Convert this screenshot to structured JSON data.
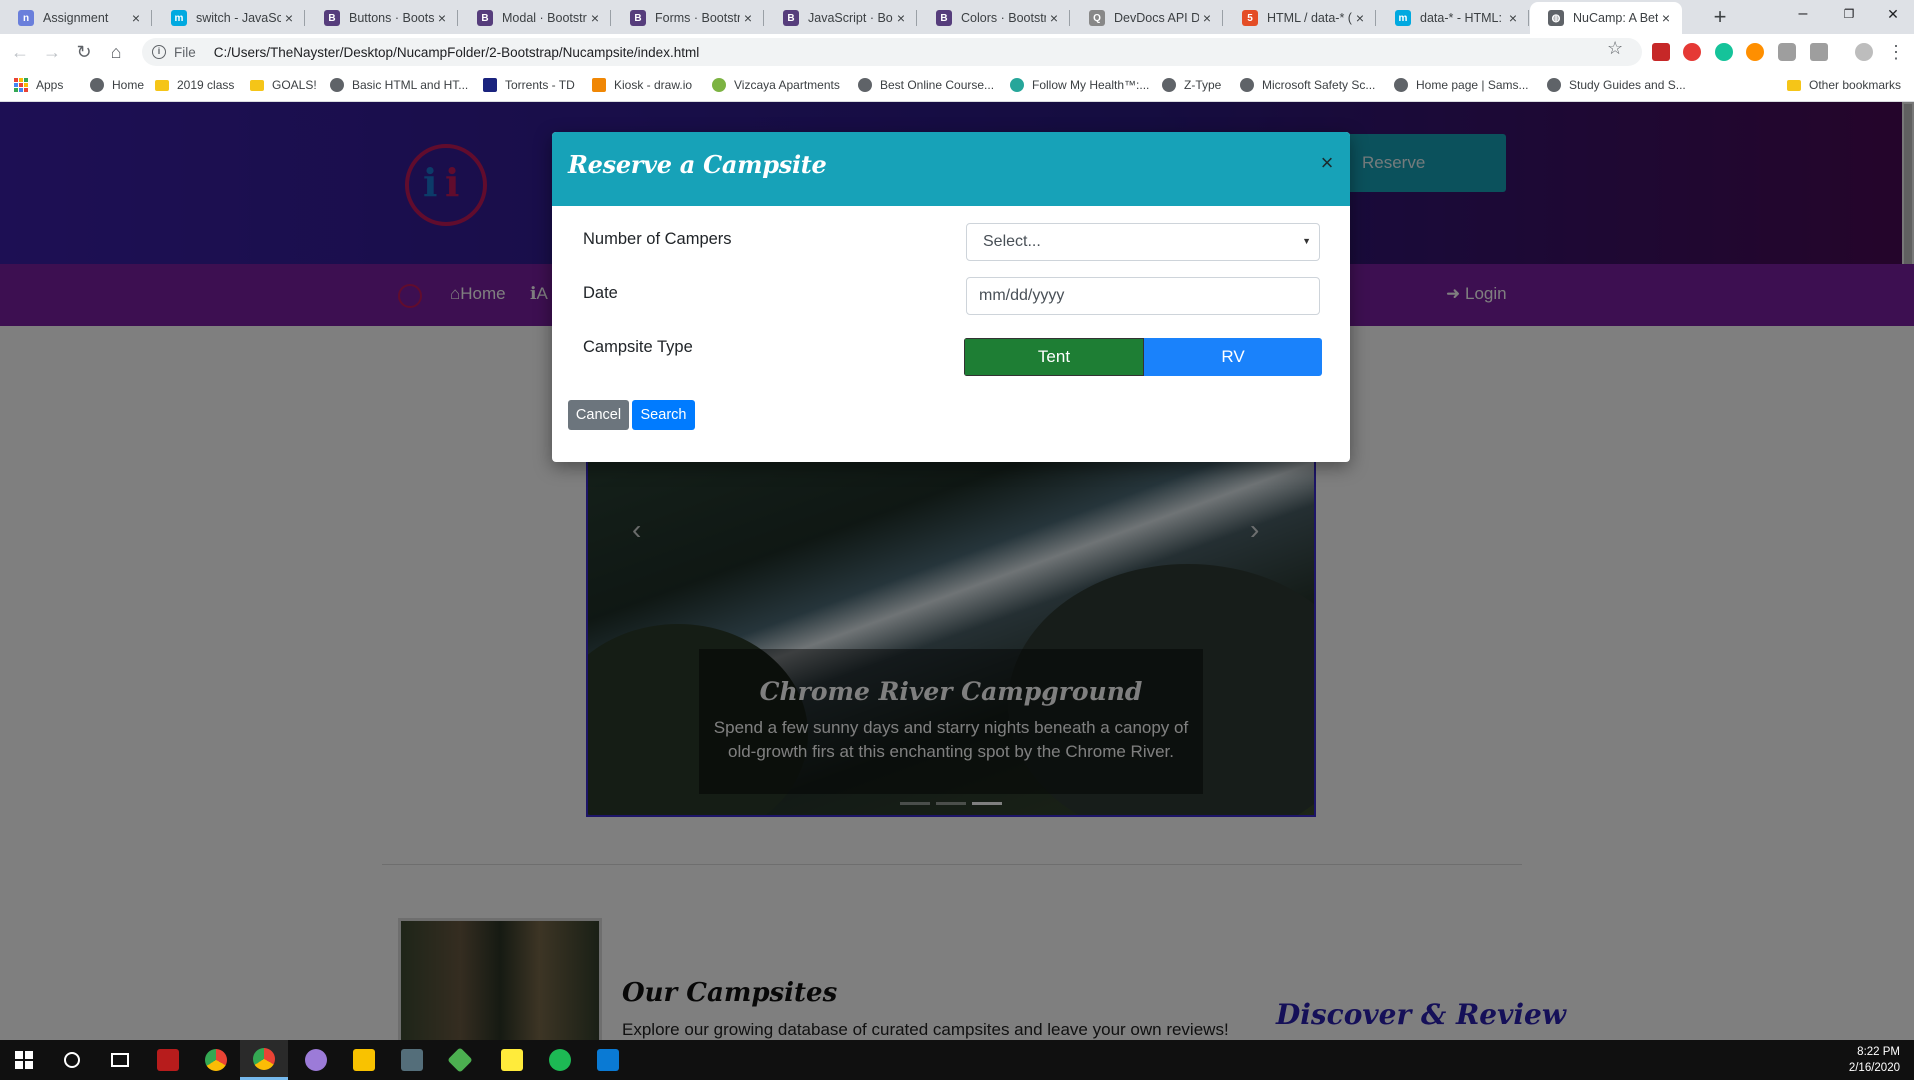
{
  "browser": {
    "tabs": [
      {
        "title": "Assignment",
        "favicon_color": "#6a7fdb",
        "favicon_glyph": "n"
      },
      {
        "title": "switch - JavaScrip",
        "favicon_color": "#00a9e0",
        "favicon_glyph": "m"
      },
      {
        "title": "Buttons · Bootstr",
        "favicon_color": "#563d7c",
        "favicon_glyph": "B"
      },
      {
        "title": "Modal · Bootstra",
        "favicon_color": "#563d7c",
        "favicon_glyph": "B"
      },
      {
        "title": "Forms · Bootstrap",
        "favicon_color": "#563d7c",
        "favicon_glyph": "B"
      },
      {
        "title": "JavaScript · Boot",
        "favicon_color": "#563d7c",
        "favicon_glyph": "B"
      },
      {
        "title": "Colors · Bootstra",
        "favicon_color": "#563d7c",
        "favicon_glyph": "B"
      },
      {
        "title": "DevDocs API Doc",
        "favicon_color": "#888888",
        "favicon_glyph": "Q"
      },
      {
        "title": "HTML / data-* (a",
        "favicon_color": "#e44d26",
        "favicon_glyph": "5"
      },
      {
        "title": "data-* - HTML: H",
        "favicon_color": "#00a9e0",
        "favicon_glyph": "m"
      },
      {
        "title": "NuCamp: A Bette",
        "favicon_color": "#5f6368",
        "favicon_glyph": "◍",
        "active": true
      }
    ],
    "new_tab_label": "+",
    "window_controls": {
      "minimize": "–",
      "maximize": "❐",
      "close": "✕"
    },
    "address": {
      "scheme": "File",
      "url": "C:/Users/TheNayster/Desktop/NucampFolder/2-Bootstrap/Nucampsite/index.html"
    },
    "bookmarks": [
      {
        "label": "Apps",
        "icon": "apps-grid-icon"
      },
      {
        "label": "Home",
        "icon": "globe-icon"
      },
      {
        "label": "2019 class",
        "icon": "folder-icon"
      },
      {
        "label": "GOALS!",
        "icon": "folder-icon"
      },
      {
        "label": "Basic HTML and HT...",
        "icon": "globe-icon"
      },
      {
        "label": "Torrents - TD",
        "icon": "td-icon"
      },
      {
        "label": "Kiosk - draw.io",
        "icon": "drawio-icon"
      },
      {
        "label": "Vizcaya Apartments",
        "icon": "lizard-icon"
      },
      {
        "label": "Best Online Course...",
        "icon": "globe-icon"
      },
      {
        "label": "Follow My Health™:...",
        "icon": "heart-icon"
      },
      {
        "label": "Z-Type",
        "icon": "globe-icon"
      },
      {
        "label": "Microsoft Safety Sc...",
        "icon": "globe-icon"
      },
      {
        "label": "Home page | Sams...",
        "icon": "globe-icon"
      },
      {
        "label": "Study Guides and S...",
        "icon": "globe-icon"
      }
    ],
    "other_bookmarks": "Other bookmarks"
  },
  "site": {
    "reserve_button": "Reserve",
    "nav": {
      "home": "Home",
      "about_partial": "A",
      "login": "Login"
    },
    "carousel": {
      "title": "Chrome River Campground",
      "text": "Spend a few sunny days and starry nights beneath a canopy of old-growth firs at this enchanting spot by the Chrome River.",
      "active_index": 2,
      "slide_count": 3
    },
    "section": {
      "title": "Our Campsites",
      "text": "Explore our growing database of curated campsites and leave your own reviews!",
      "side_heading": "Discover & Review"
    }
  },
  "modal": {
    "title": "Reserve a Campsite",
    "close_glyph": "×",
    "fields": {
      "campers_label": "Number of Campers",
      "campers_value": "Select...",
      "date_label": "Date",
      "date_placeholder": "mm/dd/yyyy",
      "type_label": "Campsite Type",
      "type_options": [
        "Tent",
        "RV"
      ],
      "type_selected": "Tent"
    },
    "buttons": {
      "cancel": "Cancel",
      "search": "Search"
    }
  },
  "taskbar": {
    "time": "8:22 PM",
    "date": "2/16/2020"
  },
  "colors": {
    "modal_header": "#17a2b8",
    "tent_active": "#1e7e34",
    "rv": "#1a82fb",
    "cancel": "#6c757d",
    "search": "#007bff",
    "navbar": "#7b1fa2"
  }
}
